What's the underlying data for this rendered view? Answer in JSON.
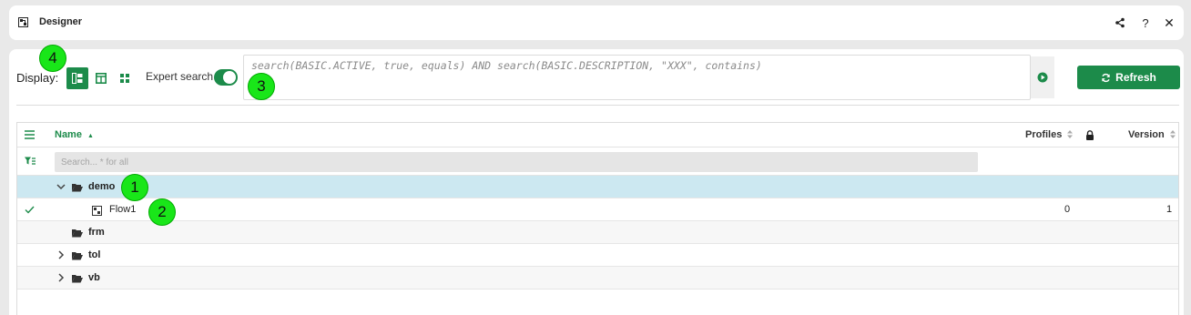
{
  "title_bar": {
    "title": "Designer",
    "icons": [
      "share-icon",
      "help-icon",
      "close-icon"
    ],
    "help_glyph": "?",
    "close_glyph": "✕"
  },
  "toolbar": {
    "display_label": "Display:",
    "view_modes": [
      "tree-view-icon",
      "split-view-icon",
      "tiles-view-icon"
    ],
    "active_view": "tree-view-icon",
    "expert_search_label": "Expert search",
    "expert_search_on": true,
    "query": "search(BASIC.ACTIVE, true, equals) AND search(BASIC.DESCRIPTION, \"XXX\", contains)",
    "refresh_label": "Refresh"
  },
  "table": {
    "columns": {
      "name": "Name",
      "profiles": "Profiles",
      "version": "Version"
    },
    "sort_indicator": "▲",
    "filter_placeholder": "Search... * for all",
    "rows": [
      {
        "label": "demo",
        "type": "folder",
        "expanded": true,
        "selected": true
      },
      {
        "label": "Flow1",
        "type": "flow",
        "checked": true,
        "profiles": "0",
        "version": "1"
      },
      {
        "label": "frm",
        "type": "folder"
      },
      {
        "label": "tol",
        "type": "folder",
        "expanded": false
      },
      {
        "label": "vb",
        "type": "folder",
        "expanded": false
      }
    ]
  },
  "markers": [
    "1",
    "2",
    "3",
    "4"
  ],
  "colors": {
    "accent": "#1c8b4a",
    "selected_row": "#cce8f1",
    "marker": "#19e619"
  }
}
